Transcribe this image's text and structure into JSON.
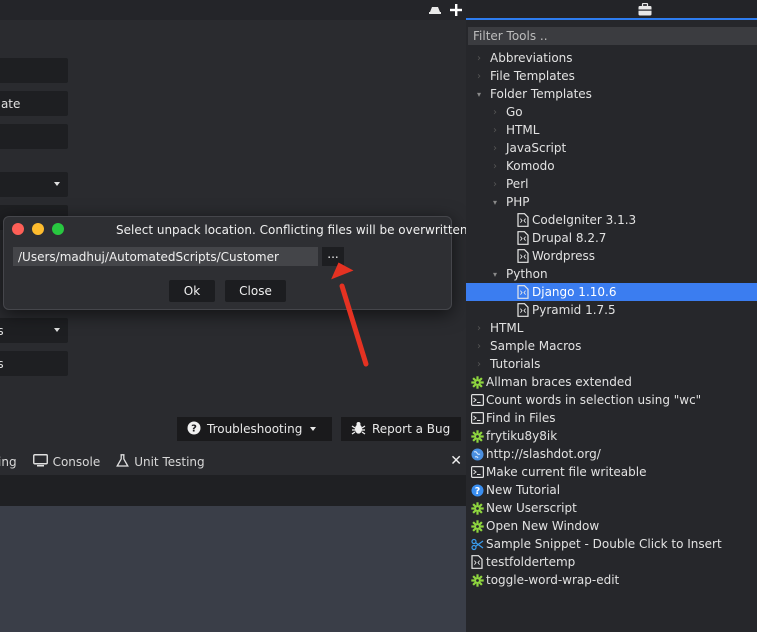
{
  "left": {
    "buttons": [
      {
        "label": "",
        "has_caret": false
      },
      {
        "label": "plate",
        "has_caret": false
      },
      {
        "label": "",
        "has_caret": false
      },
      {
        "label": "",
        "has_caret": true
      },
      {
        "label": "",
        "has_caret": false
      },
      {
        "label": "es",
        "has_caret": true
      },
      {
        "label": "es",
        "has_caret": false
      }
    ],
    "troubleshooting_label": "Troubleshooting",
    "report_bug_label": "Report a Bug",
    "tabs": [
      {
        "label": "ing",
        "icon": "none"
      },
      {
        "label": "Console",
        "icon": "monitor-icon"
      },
      {
        "label": "Unit Testing",
        "icon": "flask-icon"
      }
    ],
    "close_glyph": "✕"
  },
  "dialog": {
    "title": "Select unpack location. Conflicting files will be overwritten.",
    "path_value": "/Users/madhuj/AutomatedScripts/Customer",
    "browse_label": "...",
    "ok_label": "Ok",
    "close_label": "Close",
    "colors": {
      "close": "#fe5f57",
      "minimize": "#febc2e",
      "zoom": "#28c840"
    }
  },
  "toolbox": {
    "filter_placeholder": "Filter Tools ..",
    "items": [
      {
        "label": "Abbreviations",
        "level": 0,
        "icon": "none",
        "arrow": "right"
      },
      {
        "label": "File Templates",
        "level": 0,
        "icon": "none",
        "arrow": "right"
      },
      {
        "label": "Folder Templates",
        "level": 0,
        "icon": "none",
        "arrow": "down"
      },
      {
        "label": "Go",
        "level": 1,
        "icon": "none",
        "arrow": "right"
      },
      {
        "label": "HTML",
        "level": 1,
        "icon": "none",
        "arrow": "right"
      },
      {
        "label": "JavaScript",
        "level": 1,
        "icon": "none",
        "arrow": "right"
      },
      {
        "label": "Komodo",
        "level": 1,
        "icon": "none",
        "arrow": "right"
      },
      {
        "label": "Perl",
        "level": 1,
        "icon": "none",
        "arrow": "right"
      },
      {
        "label": "PHP",
        "level": 1,
        "icon": "none",
        "arrow": "down"
      },
      {
        "label": "CodeIgniter 3.1.3",
        "level": 2,
        "icon": "file-icon",
        "arrow": "none"
      },
      {
        "label": "Drupal 8.2.7",
        "level": 2,
        "icon": "file-icon",
        "arrow": "none"
      },
      {
        "label": "Wordpress",
        "level": 2,
        "icon": "file-icon",
        "arrow": "none"
      },
      {
        "label": "Python",
        "level": 1,
        "icon": "none",
        "arrow": "down"
      },
      {
        "label": "Django 1.10.6",
        "level": 2,
        "icon": "file-icon",
        "arrow": "none",
        "selected": true
      },
      {
        "label": "Pyramid 1.7.5",
        "level": 2,
        "icon": "file-icon",
        "arrow": "none"
      },
      {
        "label": "HTML",
        "level": 0,
        "icon": "none",
        "arrow": "right"
      },
      {
        "label": "Sample Macros",
        "level": 0,
        "icon": "none",
        "arrow": "right"
      },
      {
        "label": "Tutorials",
        "level": 0,
        "icon": "none",
        "arrow": "right"
      },
      {
        "label": "Allman braces extended",
        "level": -1,
        "icon": "gear-icon",
        "arrow": "none"
      },
      {
        "label": "Count words in selection using \"wc\"",
        "level": -1,
        "icon": "terminal-icon",
        "arrow": "none"
      },
      {
        "label": "Find in Files",
        "level": -1,
        "icon": "terminal-icon",
        "arrow": "none"
      },
      {
        "label": "frytiku8y8ik",
        "level": -1,
        "icon": "gear-icon",
        "arrow": "none"
      },
      {
        "label": "http://slashdot.org/",
        "level": -1,
        "icon": "globe-icon",
        "arrow": "none"
      },
      {
        "label": "Make current file writeable",
        "level": -1,
        "icon": "terminal-icon",
        "arrow": "none"
      },
      {
        "label": "New Tutorial",
        "level": -1,
        "icon": "help-icon",
        "arrow": "none"
      },
      {
        "label": "New Userscript",
        "level": -1,
        "icon": "gear-icon",
        "arrow": "none"
      },
      {
        "label": "Open New Window",
        "level": -1,
        "icon": "gear-icon",
        "arrow": "none"
      },
      {
        "label": "Sample Snippet - Double Click to Insert",
        "level": -1,
        "icon": "scissors-icon",
        "arrow": "none"
      },
      {
        "label": "testfoldertemp",
        "level": -1,
        "icon": "file-icon",
        "arrow": "none"
      },
      {
        "label": "toggle-word-wrap-edit",
        "level": -1,
        "icon": "gear-icon",
        "arrow": "none"
      }
    ]
  }
}
